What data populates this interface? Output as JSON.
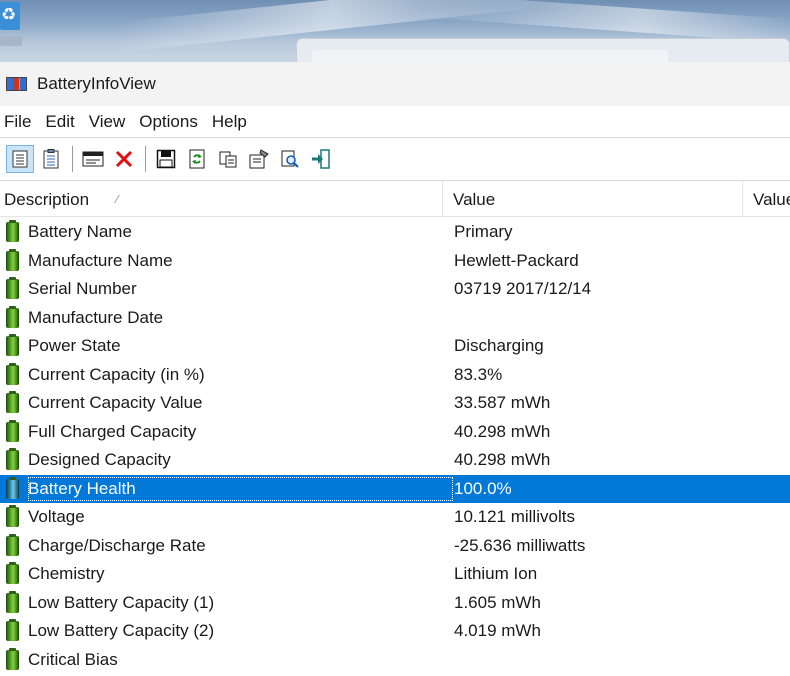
{
  "window": {
    "title": "BatteryInfoView"
  },
  "menu": [
    "File",
    "Edit",
    "View",
    "Options",
    "Help"
  ],
  "toolbar": {
    "buttons": [
      {
        "icon": "list-view-icon",
        "active": true
      },
      {
        "icon": "details-view-icon",
        "active": false
      },
      {
        "icon": "window-icon",
        "active": false
      },
      {
        "icon": "delete-x-icon",
        "active": false
      },
      {
        "icon": "save-icon",
        "active": false
      },
      {
        "icon": "refresh-icon",
        "active": false
      },
      {
        "icon": "copy-icon",
        "active": false
      },
      {
        "icon": "properties-icon",
        "active": false
      },
      {
        "icon": "find-icon",
        "active": false
      },
      {
        "icon": "exit-icon",
        "active": false
      }
    ]
  },
  "columns": {
    "description": "Description",
    "value": "Value",
    "value2": "Value"
  },
  "rows": [
    {
      "description": "Battery Name",
      "value": "Primary"
    },
    {
      "description": "Manufacture Name",
      "value": "Hewlett-Packard"
    },
    {
      "description": "Serial Number",
      "value": "03719 2017/12/14"
    },
    {
      "description": "Manufacture Date",
      "value": ""
    },
    {
      "description": "Power State",
      "value": "Discharging"
    },
    {
      "description": "Current Capacity (in %)",
      "value": "83.3%"
    },
    {
      "description": "Current Capacity Value",
      "value": "33.587 mWh"
    },
    {
      "description": "Full Charged Capacity",
      "value": "40.298 mWh"
    },
    {
      "description": "Designed Capacity",
      "value": "40.298 mWh"
    },
    {
      "description": "Battery Health",
      "value": "100.0%",
      "selected": true
    },
    {
      "description": "Voltage",
      "value": "10.121 millivolts"
    },
    {
      "description": "Charge/Discharge Rate",
      "value": "-25.636 milliwatts"
    },
    {
      "description": "Chemistry",
      "value": "Lithium Ion"
    },
    {
      "description": "Low Battery Capacity (1)",
      "value": "1.605 mWh"
    },
    {
      "description": "Low Battery Capacity (2)",
      "value": "4.019 mWh"
    },
    {
      "description": "Critical Bias",
      "value": ""
    }
  ],
  "colors": {
    "selection": "#0078d7",
    "battery_icon": "#4d9a1f"
  }
}
